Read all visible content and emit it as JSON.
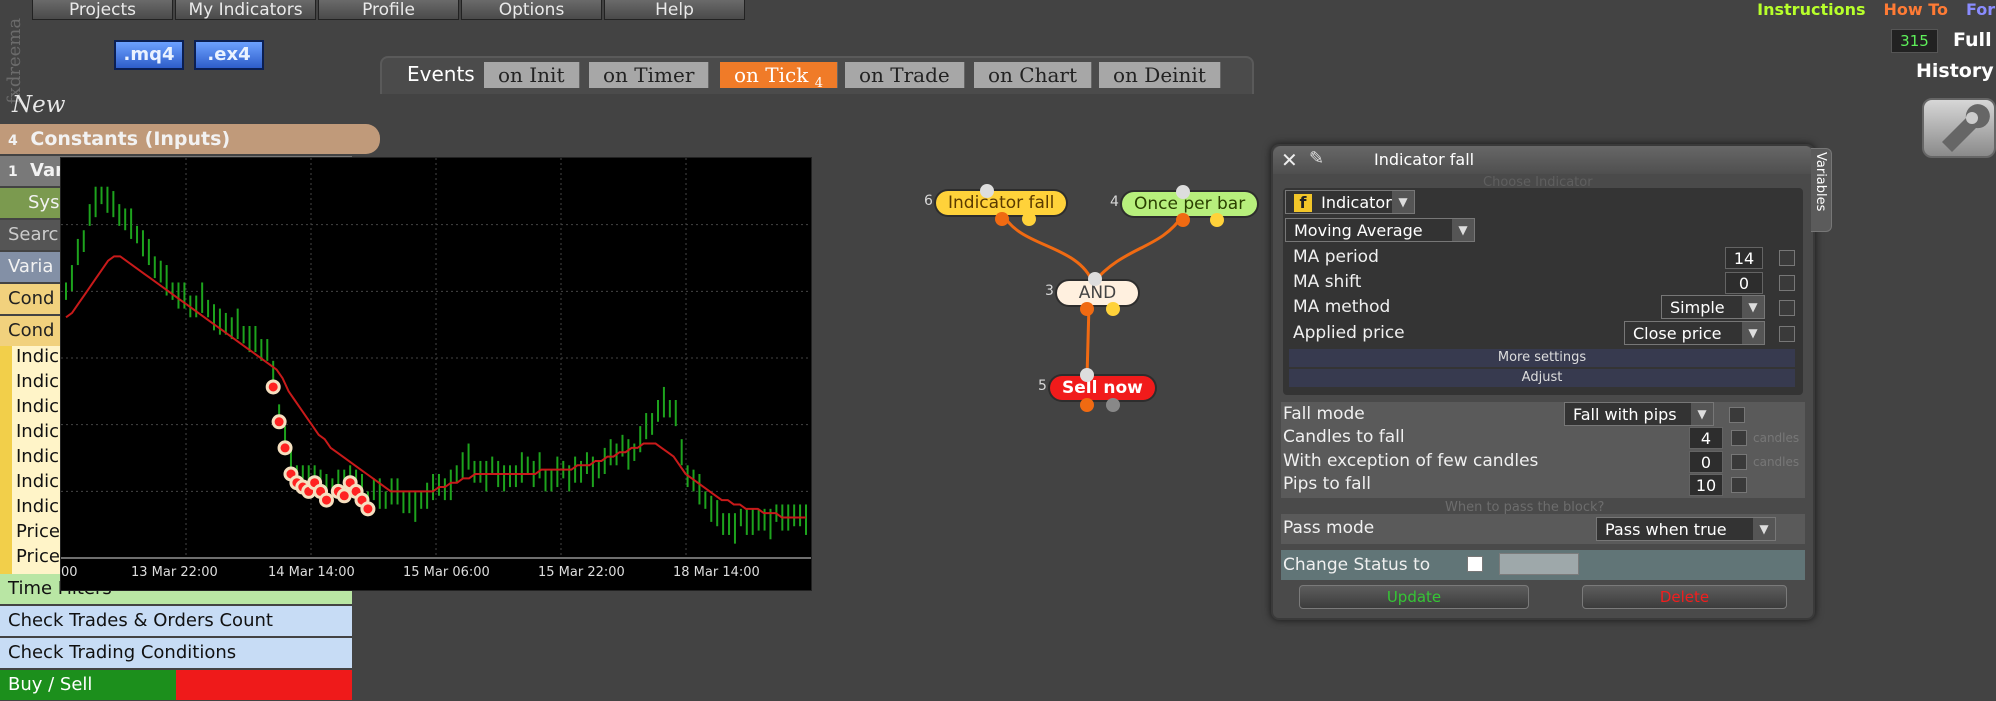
{
  "menu": [
    "Projects",
    "My Indicators",
    "Profile",
    "Options",
    "Help"
  ],
  "brand": "fxdreema",
  "top_links": [
    {
      "label": "Instructions",
      "color": "#b7ff2b"
    },
    {
      "label": "How To",
      "color": "#ff7b35"
    },
    {
      "label": "For",
      "color": "#8a8cff"
    }
  ],
  "top_right": {
    "count": "315",
    "full": "Full",
    "history": "History"
  },
  "file_buttons": [
    ".mq4",
    ".ex4"
  ],
  "events": {
    "label": "Events",
    "tabs": [
      "on Init",
      "on Timer",
      "on Tick",
      "on Trade",
      "on Chart",
      "on Deinit"
    ],
    "active_index": 2,
    "active_badge": "4"
  },
  "sidebar": {
    "new_label": "New",
    "constants_count": "4",
    "constants": "Constants (Inputs)",
    "variables_count": "1",
    "variables_short": "Var",
    "sys": "Sys",
    "search": "Search",
    "varia": "Varia",
    "cond1": "Cond",
    "cond2": "Cond",
    "list": [
      "Indic",
      "Indic",
      "Indic",
      "Indic",
      "Indic",
      "Indic",
      "Indic",
      "Price",
      "Price"
    ],
    "time_filters": "Time Filters",
    "check_trades": "Check Trades & Orders Count",
    "check_conditions": "Check Trading Conditions",
    "buy_sell": "Buy / Sell"
  },
  "chart_data": {
    "type": "line",
    "x_labels": [
      "00",
      "13 Mar 22:00",
      "14 Mar 14:00",
      "15 Mar 06:00",
      "15 Mar 22:00",
      "18 Mar 14:00"
    ],
    "series": [
      {
        "type": "candles",
        "color": "#1da31d",
        "values": [
          58,
          61,
          66,
          70,
          75,
          78,
          80,
          79,
          77,
          76,
          74,
          73,
          71,
          69,
          66,
          64,
          62,
          60,
          58,
          57,
          56,
          55,
          54,
          56,
          54,
          52,
          50,
          51,
          49,
          50,
          48,
          47,
          46,
          45,
          44,
          38,
          30,
          24,
          18,
          16,
          15,
          14,
          16,
          14,
          12,
          13,
          14,
          13,
          16,
          14,
          12,
          10,
          12,
          11,
          10,
          12,
          11,
          10,
          9,
          8,
          10,
          11,
          12,
          14,
          12,
          13,
          16,
          18,
          19,
          17,
          16,
          15,
          18,
          16,
          14,
          16,
          15,
          17,
          18,
          16,
          17,
          15,
          14,
          16,
          17,
          15,
          16,
          17,
          18,
          16,
          17,
          19,
          20,
          21,
          22,
          20,
          21,
          24,
          26,
          28,
          30,
          32,
          31,
          30,
          20,
          16,
          14,
          12,
          10,
          8,
          6,
          5,
          4,
          3,
          6,
          5,
          4,
          6,
          5,
          4,
          7,
          6,
          5,
          7,
          6,
          5
        ]
      },
      {
        "type": "moving_average",
        "color": "#c81a1a",
        "values": [
          52,
          53,
          55,
          57,
          59,
          61,
          63,
          65,
          66,
          66,
          65,
          64,
          63,
          62,
          61,
          60,
          59,
          58,
          57,
          56,
          55,
          54,
          53,
          52,
          51,
          50,
          49,
          48,
          47,
          46,
          45,
          44,
          43,
          42,
          41,
          40,
          38,
          35,
          33,
          31,
          29,
          27,
          25,
          24,
          22,
          21,
          20,
          19,
          18,
          17,
          16,
          15,
          14,
          13,
          12,
          12,
          12,
          12,
          12,
          12,
          12,
          12,
          13,
          13,
          14,
          14,
          15,
          15,
          16,
          16,
          16,
          16,
          16,
          16,
          16,
          16,
          16,
          16,
          16,
          17,
          17,
          17,
          17,
          17,
          17,
          18,
          18,
          18,
          19,
          19,
          20,
          20,
          21,
          21,
          22,
          22,
          23,
          23,
          23,
          22,
          21,
          20,
          18,
          16,
          15,
          14,
          13,
          12,
          11,
          10,
          10,
          9,
          9,
          8,
          8,
          8,
          7,
          7,
          7,
          6,
          6,
          6,
          6,
          6
        ]
      }
    ],
    "signal_markers": 16
  },
  "graph": {
    "nodes": [
      {
        "num": "6",
        "label": "Indicator fall",
        "color": "#ffd23a",
        "text_color": "#5a3a00"
      },
      {
        "num": "4",
        "label": "Once per bar",
        "color": "#b7ef7c",
        "text_color": "#2a3f00"
      },
      {
        "num": "3",
        "label": "AND",
        "color": "#fff0df",
        "text_color": "#444"
      },
      {
        "num": "5",
        "label": "Sell now",
        "color": "#f11b1b",
        "text_color": "#fff"
      }
    ]
  },
  "dialog": {
    "title": "Indicator fall",
    "variables_tab": "Variables",
    "choose_indicator": "Choose Indicator",
    "indicator_type": "Indicator",
    "indicator_name": "Moving Average",
    "params": [
      {
        "label": "MA period",
        "value": "14"
      },
      {
        "label": "MA shift",
        "value": "0"
      },
      {
        "label": "MA method",
        "value": "Simple"
      },
      {
        "label": "Applied price",
        "value": "Close price"
      }
    ],
    "more_settings": "More settings",
    "adjust": "Adjust",
    "fall_mode_label": "Fall mode",
    "fall_mode_value": "Fall with pips",
    "candles_to_fall_label": "Candles to fall",
    "candles_to_fall_value": "4",
    "candles_unit": "candles",
    "exception_label": "With exception of few candles",
    "exception_value": "0",
    "pips_label": "Pips to fall",
    "pips_value": "10",
    "when_to_pass": "When to pass the block?",
    "pass_mode_label": "Pass mode",
    "pass_mode_value": "Pass when true",
    "change_status": "Change Status to",
    "update": "Update",
    "delete": "Delete"
  }
}
